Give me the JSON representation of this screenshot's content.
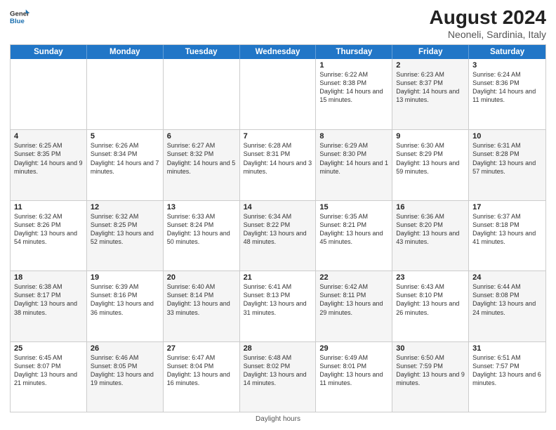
{
  "header": {
    "logo_line1": "General",
    "logo_line2": "Blue",
    "main_title": "August 2024",
    "subtitle": "Neoneli, Sardinia, Italy"
  },
  "days_of_week": [
    "Sunday",
    "Monday",
    "Tuesday",
    "Wednesday",
    "Thursday",
    "Friday",
    "Saturday"
  ],
  "footer": {
    "note": "Daylight hours"
  },
  "weeks": [
    [
      {
        "day": "",
        "info": "",
        "alt": false
      },
      {
        "day": "",
        "info": "",
        "alt": true
      },
      {
        "day": "",
        "info": "",
        "alt": false
      },
      {
        "day": "",
        "info": "",
        "alt": true
      },
      {
        "day": "1",
        "info": "Sunrise: 6:22 AM\nSunset: 8:38 PM\nDaylight: 14 hours\nand 15 minutes.",
        "alt": false
      },
      {
        "day": "2",
        "info": "Sunrise: 6:23 AM\nSunset: 8:37 PM\nDaylight: 14 hours\nand 13 minutes.",
        "alt": true
      },
      {
        "day": "3",
        "info": "Sunrise: 6:24 AM\nSunset: 8:36 PM\nDaylight: 14 hours\nand 11 minutes.",
        "alt": false
      }
    ],
    [
      {
        "day": "4",
        "info": "Sunrise: 6:25 AM\nSunset: 8:35 PM\nDaylight: 14 hours\nand 9 minutes.",
        "alt": true
      },
      {
        "day": "5",
        "info": "Sunrise: 6:26 AM\nSunset: 8:34 PM\nDaylight: 14 hours\nand 7 minutes.",
        "alt": false
      },
      {
        "day": "6",
        "info": "Sunrise: 6:27 AM\nSunset: 8:32 PM\nDaylight: 14 hours\nand 5 minutes.",
        "alt": true
      },
      {
        "day": "7",
        "info": "Sunrise: 6:28 AM\nSunset: 8:31 PM\nDaylight: 14 hours\nand 3 minutes.",
        "alt": false
      },
      {
        "day": "8",
        "info": "Sunrise: 6:29 AM\nSunset: 8:30 PM\nDaylight: 14 hours\nand 1 minute.",
        "alt": true
      },
      {
        "day": "9",
        "info": "Sunrise: 6:30 AM\nSunset: 8:29 PM\nDaylight: 13 hours\nand 59 minutes.",
        "alt": false
      },
      {
        "day": "10",
        "info": "Sunrise: 6:31 AM\nSunset: 8:28 PM\nDaylight: 13 hours\nand 57 minutes.",
        "alt": true
      }
    ],
    [
      {
        "day": "11",
        "info": "Sunrise: 6:32 AM\nSunset: 8:26 PM\nDaylight: 13 hours\nand 54 minutes.",
        "alt": false
      },
      {
        "day": "12",
        "info": "Sunrise: 6:32 AM\nSunset: 8:25 PM\nDaylight: 13 hours\nand 52 minutes.",
        "alt": true
      },
      {
        "day": "13",
        "info": "Sunrise: 6:33 AM\nSunset: 8:24 PM\nDaylight: 13 hours\nand 50 minutes.",
        "alt": false
      },
      {
        "day": "14",
        "info": "Sunrise: 6:34 AM\nSunset: 8:22 PM\nDaylight: 13 hours\nand 48 minutes.",
        "alt": true
      },
      {
        "day": "15",
        "info": "Sunrise: 6:35 AM\nSunset: 8:21 PM\nDaylight: 13 hours\nand 45 minutes.",
        "alt": false
      },
      {
        "day": "16",
        "info": "Sunrise: 6:36 AM\nSunset: 8:20 PM\nDaylight: 13 hours\nand 43 minutes.",
        "alt": true
      },
      {
        "day": "17",
        "info": "Sunrise: 6:37 AM\nSunset: 8:18 PM\nDaylight: 13 hours\nand 41 minutes.",
        "alt": false
      }
    ],
    [
      {
        "day": "18",
        "info": "Sunrise: 6:38 AM\nSunset: 8:17 PM\nDaylight: 13 hours\nand 38 minutes.",
        "alt": true
      },
      {
        "day": "19",
        "info": "Sunrise: 6:39 AM\nSunset: 8:16 PM\nDaylight: 13 hours\nand 36 minutes.",
        "alt": false
      },
      {
        "day": "20",
        "info": "Sunrise: 6:40 AM\nSunset: 8:14 PM\nDaylight: 13 hours\nand 33 minutes.",
        "alt": true
      },
      {
        "day": "21",
        "info": "Sunrise: 6:41 AM\nSunset: 8:13 PM\nDaylight: 13 hours\nand 31 minutes.",
        "alt": false
      },
      {
        "day": "22",
        "info": "Sunrise: 6:42 AM\nSunset: 8:11 PM\nDaylight: 13 hours\nand 29 minutes.",
        "alt": true
      },
      {
        "day": "23",
        "info": "Sunrise: 6:43 AM\nSunset: 8:10 PM\nDaylight: 13 hours\nand 26 minutes.",
        "alt": false
      },
      {
        "day": "24",
        "info": "Sunrise: 6:44 AM\nSunset: 8:08 PM\nDaylight: 13 hours\nand 24 minutes.",
        "alt": true
      }
    ],
    [
      {
        "day": "25",
        "info": "Sunrise: 6:45 AM\nSunset: 8:07 PM\nDaylight: 13 hours\nand 21 minutes.",
        "alt": false
      },
      {
        "day": "26",
        "info": "Sunrise: 6:46 AM\nSunset: 8:05 PM\nDaylight: 13 hours\nand 19 minutes.",
        "alt": true
      },
      {
        "day": "27",
        "info": "Sunrise: 6:47 AM\nSunset: 8:04 PM\nDaylight: 13 hours\nand 16 minutes.",
        "alt": false
      },
      {
        "day": "28",
        "info": "Sunrise: 6:48 AM\nSunset: 8:02 PM\nDaylight: 13 hours\nand 14 minutes.",
        "alt": true
      },
      {
        "day": "29",
        "info": "Sunrise: 6:49 AM\nSunset: 8:01 PM\nDaylight: 13 hours\nand 11 minutes.",
        "alt": false
      },
      {
        "day": "30",
        "info": "Sunrise: 6:50 AM\nSunset: 7:59 PM\nDaylight: 13 hours\nand 9 minutes.",
        "alt": true
      },
      {
        "day": "31",
        "info": "Sunrise: 6:51 AM\nSunset: 7:57 PM\nDaylight: 13 hours\nand 6 minutes.",
        "alt": false
      }
    ]
  ]
}
